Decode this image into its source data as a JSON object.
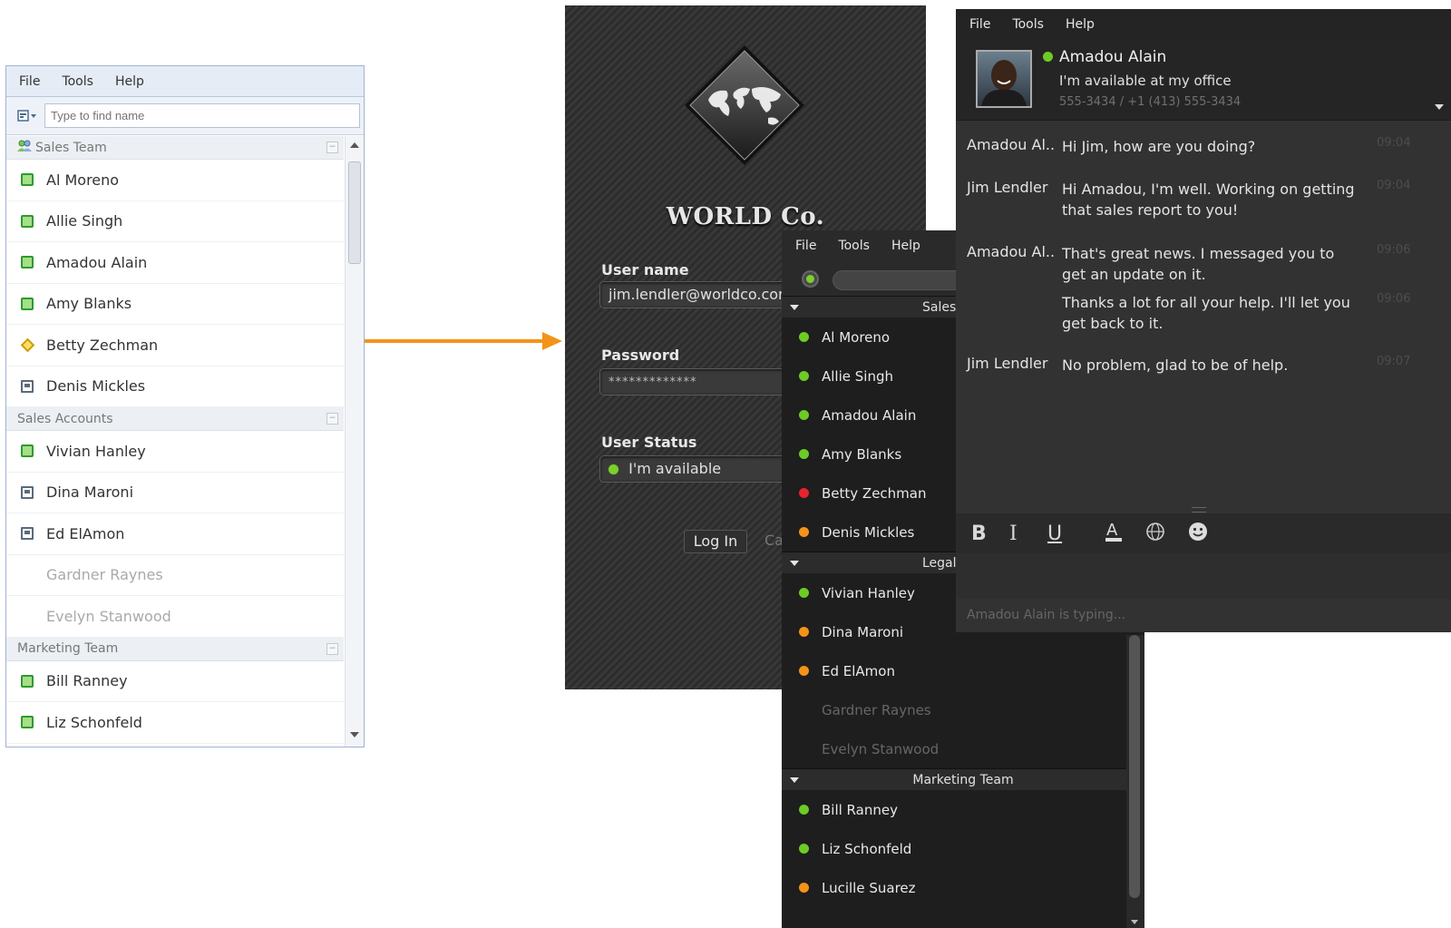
{
  "light_window": {
    "menu": [
      "File",
      "Tools",
      "Help"
    ],
    "search_placeholder": "Type to find name",
    "groups": [
      {
        "name": "Sales Team",
        "contacts": [
          {
            "name": "Al Moreno",
            "status": "online"
          },
          {
            "name": "Allie Singh",
            "status": "online"
          },
          {
            "name": "Amadou Alain",
            "status": "online"
          },
          {
            "name": "Amy Blanks",
            "status": "online"
          },
          {
            "name": "Betty Zechman",
            "status": "away"
          },
          {
            "name": "Denis Mickles",
            "status": "busy"
          }
        ]
      },
      {
        "name": "Sales Accounts",
        "contacts": [
          {
            "name": "Vivian Hanley",
            "status": "online"
          },
          {
            "name": "Dina Maroni",
            "status": "busy"
          },
          {
            "name": "Ed ElAmon",
            "status": "busy"
          },
          {
            "name": "Gardner Raynes",
            "status": "offline"
          },
          {
            "name": "Evelyn Stanwood",
            "status": "offline"
          }
        ]
      },
      {
        "name": "Marketing Team",
        "contacts": [
          {
            "name": "Bill Ranney",
            "status": "online"
          },
          {
            "name": "Liz Schonfeld",
            "status": "online"
          }
        ]
      }
    ]
  },
  "arrow_color": "#f39418",
  "login_window": {
    "brand": "WORLD Co.",
    "username_label": "User name",
    "username_value": "jim.lendler@worldco.com",
    "password_label": "Password",
    "password_value": "*************",
    "status_label": "User Status",
    "status_value": "I'm available",
    "login_button": "Log In",
    "cancel_button": "Ca"
  },
  "dark_window": {
    "menu": [
      "File",
      "Tools",
      "Help"
    ],
    "groups": [
      {
        "name": "Sales",
        "contacts": [
          {
            "name": "Al Moreno",
            "status": "online"
          },
          {
            "name": "Allie Singh",
            "status": "online"
          },
          {
            "name": "Amadou Alain",
            "status": "online"
          },
          {
            "name": "Amy Blanks",
            "status": "online"
          },
          {
            "name": "Betty Zechman",
            "status": "busy"
          },
          {
            "name": "Denis Mickles",
            "status": "away"
          }
        ]
      },
      {
        "name": "Legal",
        "contacts": [
          {
            "name": "Vivian Hanley",
            "status": "online"
          },
          {
            "name": "Dina Maroni",
            "status": "away"
          },
          {
            "name": "Ed ElAmon",
            "status": "away"
          },
          {
            "name": "Gardner Raynes",
            "status": "offline"
          },
          {
            "name": "Evelyn Stanwood",
            "status": "offline"
          }
        ]
      },
      {
        "name": "Marketing Team",
        "contacts": [
          {
            "name": "Bill Ranney",
            "status": "online"
          },
          {
            "name": "Liz Schonfeld",
            "status": "online"
          },
          {
            "name": "Lucille Suarez",
            "status": "away"
          }
        ]
      }
    ]
  },
  "chat_window": {
    "menu": [
      "File",
      "Tools",
      "Help"
    ],
    "contact_name": "Amadou Alain",
    "contact_status": "I'm available at my office",
    "contact_phone": "555-3434 / +1 (413) 555-3434",
    "messages": [
      {
        "sender": "Amadou Al..",
        "text": "Hi Jim, how are you doing?",
        "time": "09:04"
      },
      {
        "sender": "Jim Lendler",
        "text": "Hi Amadou, I'm well.  Working on getting that sales report to you!",
        "time": "09:04"
      },
      {
        "sender": "Amadou Al..",
        "text": "That's great news. I messaged you to get an update on it.",
        "time": "09:06"
      },
      {
        "sender": "",
        "text": "Thanks a lot for all your help. I'll let you get back to it.",
        "time": "09:06"
      },
      {
        "sender": "Jim Lendler",
        "text": "No problem, glad to be of help.",
        "time": "09:07"
      }
    ],
    "format_buttons": [
      "B",
      "I",
      "U"
    ],
    "typing_indicator": "Amadou Alain is typing..."
  }
}
